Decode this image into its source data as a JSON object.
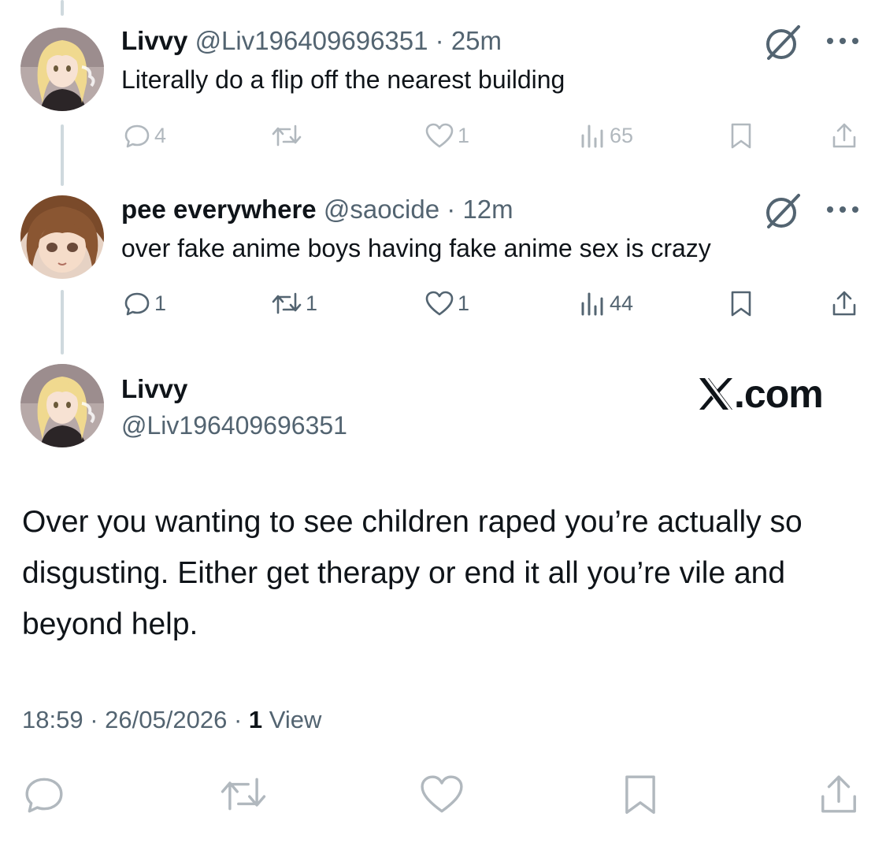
{
  "colors": {
    "text": "#0f1419",
    "muted": "#536471",
    "thread_line": "#cfd9de",
    "background": "#ffffff"
  },
  "tweets": [
    {
      "display_name": "Livvy",
      "handle": "@Liv196409696351",
      "separator": "·",
      "time": "25m",
      "text": "Literally do a flip off the nearest building",
      "replies": "4",
      "retweets": "",
      "likes": "1",
      "views": "65",
      "icons": {
        "grok": "grok-icon",
        "more": "more-icon"
      }
    },
    {
      "display_name": "pee everywhere",
      "handle": "@saocide",
      "separator": "·",
      "time": "12m",
      "text": "over fake anime boys having fake anime sex is crazy",
      "replies": "1",
      "retweets": "1",
      "likes": "1",
      "views": "44",
      "icons": {
        "grok": "grok-icon",
        "more": "more-icon"
      }
    }
  ],
  "main_tweet": {
    "display_name": "Livvy",
    "handle": "@Liv196409696351",
    "text": "Over you wanting to see children raped you’re actually so disgusting. Either get therapy or end it all you’re vile and beyond help.",
    "time": "18:59",
    "separator": "·",
    "date": "26/05/2026",
    "views_count": "1",
    "views_label": "View"
  },
  "watermark": {
    "domain": ".com"
  }
}
